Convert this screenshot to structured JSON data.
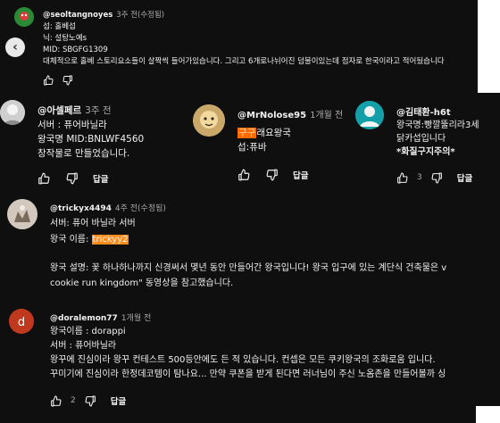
{
  "comments": [
    {
      "author": "@seoltangnoyes",
      "time": "3주 전(수정됨)",
      "lines": [
        "섭: 홀베섭",
        "닉: 설탕노예s",
        "MID: SBGFG1309",
        "대체적으로 홀베 스토리요소들이 살짝씩 들어가있습니다. 그리고 6개로나뉘어진 덤불이있는데 점자로 한국이라고 적어뒀습니다"
      ],
      "reply_label": ""
    },
    {
      "author": "@아셀페르",
      "time": "3주 전",
      "lines": [
        "서버 : 퓨어바닐라",
        "왕국명 MID:BNLWF4560",
        "창작물로 만들었습니다."
      ],
      "reply_label": "답글"
    },
    {
      "author": "@MrNolose95",
      "time": "1개월 전",
      "highlight": "구구",
      "line1_rest": "래요왕국",
      "lines": [
        "섭:퓨바"
      ],
      "reply_label": "답글"
    },
    {
      "author": "@김태환-h6t",
      "lines": [
        "왕국명:빵깔뚤리라3세",
        "닭카섭입니다",
        "*화질구지주의*"
      ],
      "likes": "3",
      "reply_label": "답글"
    },
    {
      "author": "@trickyx4494",
      "time": "4주 전(수정됨)",
      "line1": "서버: 퓨어 바닐라 서버",
      "kingdom_prefix": "왕국 이름: ",
      "kingdom_name": "trickyy2",
      "desc1": "왕국 설명: 꽃 하나하나까지 신경써서 몇년 동안 만들어간 왕국입니다! 왕국 입구에 있는 계단식 건축물은 v",
      "desc2": "cookie run kingdom\" 동영상을 참고했습니다."
    },
    {
      "author": "@doralemon77",
      "time": "1개월 전",
      "lines": [
        "왕국이름 : dorappi",
        "서버 : 퓨어바닐라",
        "왕꾸에 진심이라 왕꾸 컨테스트 500등안에도 든 적 있습니다. 컨셉은 모든 쿠키왕국의 조화로움 입니다.",
        "꾸미기에 진심이라 한정데코템이 탐나요... 만약 쿠폰을 받게 된다면 러너님이 주신 노옴존을 만들어볼까 싱"
      ],
      "likes": "2",
      "reply_label": "답글"
    }
  ],
  "nav": {
    "prev_arrow": "‹"
  },
  "colors": {
    "background": "#0f0f0f",
    "highlight": "#ff8c1a"
  }
}
